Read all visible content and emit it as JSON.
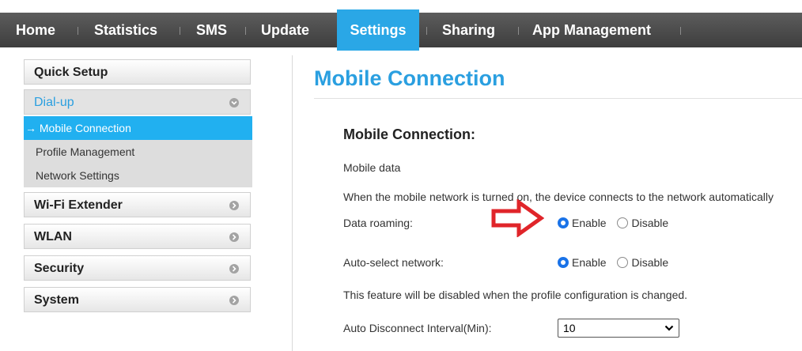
{
  "nav": {
    "items": [
      "Home",
      "Statistics",
      "SMS",
      "Update",
      "Settings",
      "Sharing",
      "App Management"
    ],
    "active": "Settings"
  },
  "sidebar": {
    "quick_setup": "Quick Setup",
    "dial_up": "Dial-up",
    "dial_up_items": [
      "Mobile Connection",
      "Profile Management",
      "Network Settings"
    ],
    "active_item_prefix": "→",
    "wifi_extender": "Wi-Fi Extender",
    "wlan": "WLAN",
    "security": "Security",
    "system": "System"
  },
  "main": {
    "page_title": "Mobile Connection",
    "section_title": "Mobile Connection:",
    "mobile_data_label": "Mobile data",
    "mobile_data_desc": "When the mobile network is turned on, the device connects to the network automatically",
    "data_roaming_label": "Data roaming:",
    "data_roaming": {
      "enable": "Enable",
      "disable": "Disable",
      "selected": "Enable"
    },
    "auto_select_label": "Auto-select network:",
    "auto_select": {
      "enable": "Enable",
      "disable": "Disable",
      "selected": "Enable"
    },
    "profile_note": "This feature will be disabled when the profile configuration is changed.",
    "auto_disconnect_label": "Auto Disconnect Interval(Min):",
    "auto_disconnect_value": "10"
  },
  "colors": {
    "accent": "#2aa7e6",
    "title_blue": "#2a9fe0",
    "nav_dark": "#4a4a4a",
    "annotation_arrow": "#e0252a"
  }
}
